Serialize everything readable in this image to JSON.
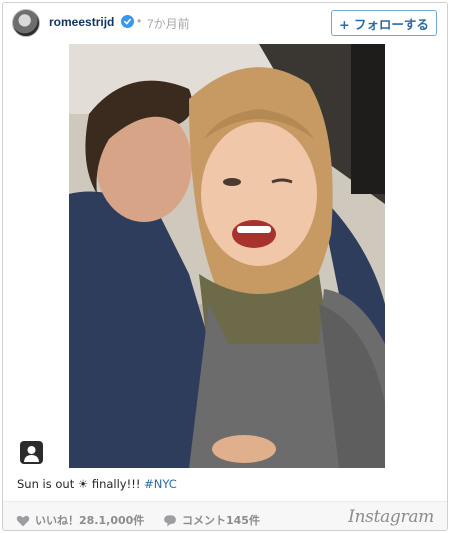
{
  "header": {
    "avatar_icon": "profile-avatar",
    "username": "romeestrijd",
    "verified_icon": "verified-badge-icon",
    "separator": "•",
    "time": "7か月前",
    "follow_label": "+ フォローする"
  },
  "post": {
    "image_description_icon": "photo",
    "user_tag_icon": "user-tag-icon"
  },
  "caption": {
    "text": "Sun is out ☀ finally!!! ",
    "hashtag": "#NYC"
  },
  "footer": {
    "like_icon": "heart-icon",
    "likes_text": "いいね！28.1,000件",
    "comment_icon": "comment-icon",
    "comments_text": "コメント145件",
    "logo": "Instagram"
  },
  "colors": {
    "link": "#2d6aa0",
    "username": "#12355b",
    "verified": "#3897f0",
    "muted": "#8a8c8f"
  }
}
